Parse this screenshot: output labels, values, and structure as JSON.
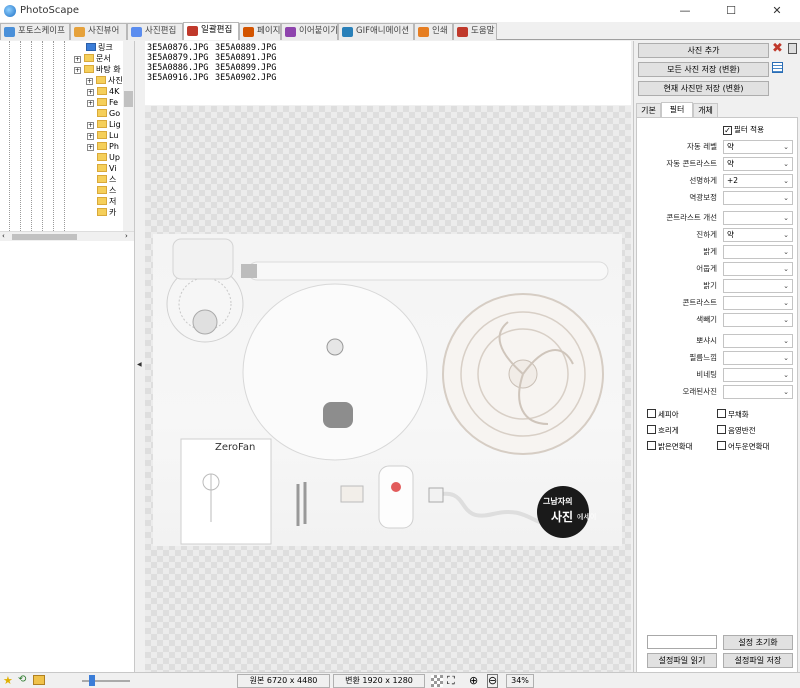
{
  "window": {
    "title": "PhotoScape",
    "minimize": "—",
    "maximize": "☐",
    "close": "✕"
  },
  "tabs": [
    {
      "label": "포토스케이프",
      "color": "#4a90d9"
    },
    {
      "label": "사진뷰어",
      "color": "#e6a23c"
    },
    {
      "label": "사진편집",
      "color": "#5b8def"
    },
    {
      "label": "일괄편집",
      "color": "#c0392b"
    },
    {
      "label": "페이지",
      "color": "#d35400"
    },
    {
      "label": "이어붙이기",
      "color": "#8e44ad"
    },
    {
      "label": "GIF애니메이션",
      "color": "#2980b9"
    },
    {
      "label": "인쇄",
      "color": "#e67e22"
    },
    {
      "label": "도움말",
      "color": "#c0392b"
    }
  ],
  "tree": {
    "items": [
      {
        "label": "링크",
        "type": "link"
      },
      {
        "label": "문서",
        "type": "expand"
      },
      {
        "label": "바탕 화",
        "type": "expand"
      },
      {
        "label": "사진",
        "type": "expand"
      },
      {
        "label": "4K",
        "type": "expand"
      },
      {
        "label": "Fe",
        "type": "expand"
      },
      {
        "label": "Go",
        "type": "folder"
      },
      {
        "label": "Lig",
        "type": "expand"
      },
      {
        "label": "Lu",
        "type": "expand"
      },
      {
        "label": "Ph",
        "type": "expand"
      },
      {
        "label": "Up",
        "type": "folder"
      },
      {
        "label": "Vi",
        "type": "folder"
      },
      {
        "label": "스",
        "type": "folder"
      },
      {
        "label": "스",
        "type": "folder"
      },
      {
        "label": "저",
        "type": "folder"
      },
      {
        "label": "카",
        "type": "folder"
      }
    ]
  },
  "files": [
    [
      "3E5A0876.JPG",
      "3E5A0889.JPG"
    ],
    [
      "3E5A0879.JPG",
      "3E5A0891.JPG"
    ],
    [
      "3E5A0886.JPG",
      "3E5A0899.JPG"
    ],
    [
      "3E5A0916.JPG",
      "3E5A0902.JPG"
    ]
  ],
  "photo": {
    "manual_brand": "ZeroFan",
    "watermark_line1": "그남자의",
    "watermark_line2": "사진",
    "watermark_line3": "에세이"
  },
  "right": {
    "add_photo": "사진 추가",
    "save_all": "모든 사진 저장 (변환)",
    "save_current": "현재 사진만 저장 (변환)",
    "tabs": {
      "basic": "기본",
      "filter": "필터",
      "object": "개체"
    },
    "filter_apply_label": "필터 적용",
    "filter_apply_mark": "✓",
    "filters": [
      {
        "label": "자동 레벨",
        "value": "약"
      },
      {
        "label": "자동 콘트라스트",
        "value": "약"
      },
      {
        "label": "선명하게",
        "value": "+2"
      },
      {
        "label": "역광보정",
        "value": ""
      },
      {
        "label": "콘트라스트 개선",
        "value": ""
      },
      {
        "label": "진하게",
        "value": "약"
      },
      {
        "label": "밝게",
        "value": ""
      },
      {
        "label": "어둡게",
        "value": ""
      },
      {
        "label": "밝기",
        "value": ""
      },
      {
        "label": "콘트라스트",
        "value": ""
      },
      {
        "label": "색빼기",
        "value": ""
      },
      {
        "label": "뽀샤시",
        "value": ""
      },
      {
        "label": "필름느낌",
        "value": ""
      },
      {
        "label": "비네팅",
        "value": ""
      },
      {
        "label": "오래된사진",
        "value": ""
      }
    ],
    "checks": [
      {
        "label": "세피아",
        "checked": false
      },
      {
        "label": "무채화",
        "checked": false
      },
      {
        "label": "흐리게",
        "checked": false
      },
      {
        "label": "음영반전",
        "checked": false
      },
      {
        "label": "밝은면확대",
        "checked": false
      },
      {
        "label": "어두운면확대",
        "checked": false
      }
    ],
    "reset_button": "설정 초기화",
    "load_settings": "설정파일 읽기",
    "save_settings": "설정파일 저장"
  },
  "status": {
    "original": "원본 6720 x 4480",
    "converted": "변환 1920 x 1280",
    "zoom": "34%"
  }
}
